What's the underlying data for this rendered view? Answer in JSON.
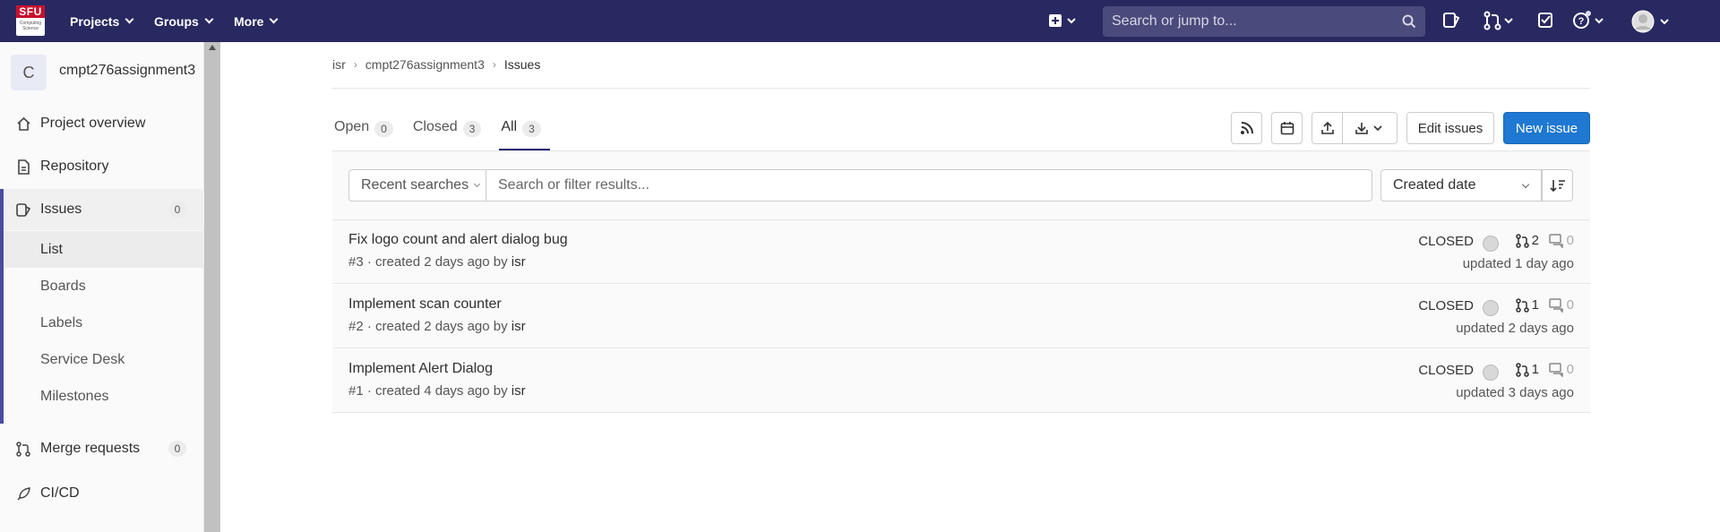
{
  "topnav": {
    "logo_line1": "SFU",
    "logo_line2": "Computing Science",
    "projects": "Projects",
    "groups": "Groups",
    "more": "More",
    "search_placeholder": "Search or jump to..."
  },
  "sidebar": {
    "project_initial": "C",
    "project_name": "cmpt276assignment3",
    "items": [
      {
        "label": "Project overview",
        "icon": "home-icon"
      },
      {
        "label": "Repository",
        "icon": "doc-icon"
      },
      {
        "label": "Issues",
        "icon": "issues-icon",
        "count": "0"
      },
      {
        "label": "Merge requests",
        "icon": "merge-request-icon",
        "count": "0"
      },
      {
        "label": "CI/CD",
        "icon": "rocket-icon"
      }
    ],
    "issues_sub": [
      "List",
      "Boards",
      "Labels",
      "Service Desk",
      "Milestones"
    ]
  },
  "breadcrumbs": [
    "isr",
    "cmpt276assignment3",
    "Issues"
  ],
  "tabs": [
    {
      "label": "Open",
      "count": "0"
    },
    {
      "label": "Closed",
      "count": "3"
    },
    {
      "label": "All",
      "count": "3"
    }
  ],
  "actions": {
    "edit_issues": "Edit issues",
    "new_issue": "New issue"
  },
  "filter": {
    "recent_searches": "Recent searches",
    "placeholder": "Search or filter results...",
    "sort": "Created date"
  },
  "issues": [
    {
      "title": "Fix logo count and alert dialog bug",
      "meta": "#3 · created 2 days ago by ",
      "author": "isr",
      "state": "CLOSED",
      "mrs": "2",
      "comments": "0",
      "updated": "updated 1 day ago"
    },
    {
      "title": "Implement scan counter",
      "meta": "#2 · created 2 days ago by ",
      "author": "isr",
      "state": "CLOSED",
      "mrs": "1",
      "comments": "0",
      "updated": "updated 2 days ago"
    },
    {
      "title": "Implement Alert Dialog",
      "meta": "#1 · created 4 days ago by ",
      "author": "isr",
      "state": "CLOSED",
      "mrs": "1",
      "comments": "0",
      "updated": "updated 3 days ago"
    }
  ],
  "colors": {
    "nav_bg": "#292961",
    "primary": "#1f78d1",
    "sidebar_accent": "#4b4ba3"
  }
}
